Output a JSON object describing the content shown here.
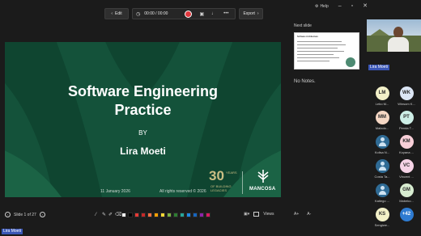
{
  "window": {
    "help_label": "Help",
    "minimize_glyph": "–",
    "maximize_glyph": "▫",
    "close_glyph": "✕"
  },
  "toolbar": {
    "edit_label": "Edit",
    "timer": "00:00 / 00:00",
    "export_label": "Export"
  },
  "slide": {
    "title_line1": "Software Engineering",
    "title_line2": "Practice",
    "by": "BY",
    "author": "Lira Moeti",
    "date": "11 January 2026",
    "rights": "All rights reserved © 2026",
    "logo_years": "30",
    "logo_years_word": "YEARS",
    "logo_tagline": "OF BUILDING LEGACIES",
    "brand": "MANCOSA"
  },
  "next_slide": {
    "label": "Next slide",
    "thumb_title": "Software Architecture"
  },
  "notes": {
    "text": "No Notes."
  },
  "bottom": {
    "slide_counter": "Slide 1 of 27",
    "view_label": "Views",
    "zoom_in": "A+",
    "zoom_out": "A-",
    "pen_colors": [
      "#ffffff",
      "#000000",
      "#e53935",
      "#c62828",
      "#ff7043",
      "#ffa000",
      "#fdd835",
      "#7cb342",
      "#2e7d32",
      "#26a69a",
      "#1e88e5",
      "#1565c0",
      "#8e24aa",
      "#d81b60"
    ]
  },
  "presenter": {
    "name": "Lira Moeti"
  },
  "participants": [
    {
      "initials": "LM",
      "name": "Lebo M...",
      "color": "#f2f0c8",
      "type": "initials"
    },
    {
      "initials": "WK",
      "name": "Winsom K...",
      "color": "#dce6f5",
      "type": "initials"
    },
    {
      "initials": "MM",
      "name": "Mabolo...",
      "color": "#f5d7c4",
      "type": "initials"
    },
    {
      "initials": "PT",
      "name": "Penda T...",
      "color": "#cdeee6",
      "type": "initials"
    },
    {
      "initials": "",
      "name": "Kolisa N...",
      "color": "#2f6b95",
      "type": "icon"
    },
    {
      "initials": "KM",
      "name": "Koyana ...",
      "color": "#f8cfd8",
      "type": "initials"
    },
    {
      "initials": "",
      "name": "Costa Ta...",
      "color": "#2f6b95",
      "type": "icon"
    },
    {
      "initials": "VC",
      "name": "Vincent ...",
      "color": "#f5d3e6",
      "type": "initials"
    },
    {
      "initials": "",
      "name": "Katlego ...",
      "color": "#2f6b95",
      "type": "icon"
    },
    {
      "initials": "GM",
      "name": "Mabeko...",
      "color": "#d7ecd0",
      "type": "initials"
    },
    {
      "initials": "KS",
      "name": "Sengiwe...",
      "color": "#f2f0c8",
      "type": "initials"
    },
    {
      "initials": "+42",
      "name": "",
      "color": "#2e7bd1",
      "type": "more"
    }
  ]
}
